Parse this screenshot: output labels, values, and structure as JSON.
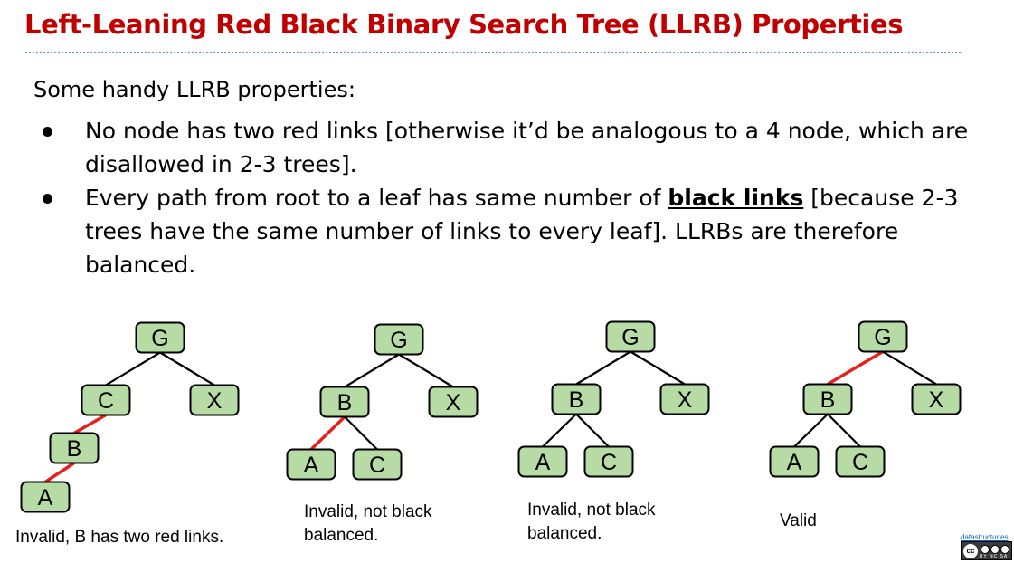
{
  "title": "Left-Leaning Red Black Binary Search Tree (LLRB) Properties",
  "intro": "Some handy LLRB properties:",
  "bullets": [
    {
      "text": "No node has two red links [otherwise it’d be analogous to a 4 node, which are disallowed in 2-3 trees]."
    },
    {
      "before": "Every path from root to a leaf has same number of ",
      "emphasis": "black links",
      "after": " [because 2-3 trees have the same number of links to every leaf]. LLRBs are therefore balanced."
    }
  ],
  "colors": {
    "title": "#c00000",
    "rule": "#5b9bd5",
    "node_fill": "#b7dba5",
    "red_link": "#e8201d",
    "black_link": "#000000"
  },
  "trees": [
    {
      "caption": "Invalid, B has two red links.",
      "nodes": [
        {
          "id": "G",
          "label": "G"
        },
        {
          "id": "C",
          "label": "C"
        },
        {
          "id": "X",
          "label": "X"
        },
        {
          "id": "B",
          "label": "B"
        },
        {
          "id": "A",
          "label": "A"
        }
      ],
      "links": [
        {
          "from": "G",
          "to": "C",
          "color": "black"
        },
        {
          "from": "G",
          "to": "X",
          "color": "black"
        },
        {
          "from": "C",
          "to": "B",
          "color": "red"
        },
        {
          "from": "B",
          "to": "A",
          "color": "red"
        }
      ]
    },
    {
      "caption": "Invalid, not black balanced.",
      "nodes": [
        {
          "id": "G",
          "label": "G"
        },
        {
          "id": "B",
          "label": "B"
        },
        {
          "id": "X",
          "label": "X"
        },
        {
          "id": "A",
          "label": "A"
        },
        {
          "id": "C",
          "label": "C"
        }
      ],
      "links": [
        {
          "from": "G",
          "to": "B",
          "color": "black"
        },
        {
          "from": "G",
          "to": "X",
          "color": "black"
        },
        {
          "from": "B",
          "to": "A",
          "color": "red"
        },
        {
          "from": "B",
          "to": "C",
          "color": "black"
        }
      ]
    },
    {
      "caption": "Invalid, not black balanced.",
      "nodes": [
        {
          "id": "G",
          "label": "G"
        },
        {
          "id": "B",
          "label": "B"
        },
        {
          "id": "X",
          "label": "X"
        },
        {
          "id": "A",
          "label": "A"
        },
        {
          "id": "C",
          "label": "C"
        }
      ],
      "links": [
        {
          "from": "G",
          "to": "B",
          "color": "black"
        },
        {
          "from": "G",
          "to": "X",
          "color": "black"
        },
        {
          "from": "B",
          "to": "A",
          "color": "black"
        },
        {
          "from": "B",
          "to": "C",
          "color": "black"
        }
      ]
    },
    {
      "caption": "Valid",
      "nodes": [
        {
          "id": "G",
          "label": "G"
        },
        {
          "id": "B",
          "label": "B"
        },
        {
          "id": "X",
          "label": "X"
        },
        {
          "id": "A",
          "label": "A"
        },
        {
          "id": "C",
          "label": "C"
        }
      ],
      "links": [
        {
          "from": "G",
          "to": "B",
          "color": "red"
        },
        {
          "from": "G",
          "to": "X",
          "color": "black"
        },
        {
          "from": "B",
          "to": "A",
          "color": "black"
        },
        {
          "from": "B",
          "to": "C",
          "color": "black"
        }
      ]
    }
  ],
  "footer": {
    "site": "datastructur.es",
    "license_icon": "cc-by-nc-sa-icon",
    "license_mark": "cc",
    "license_tags": "BY NC SA"
  }
}
